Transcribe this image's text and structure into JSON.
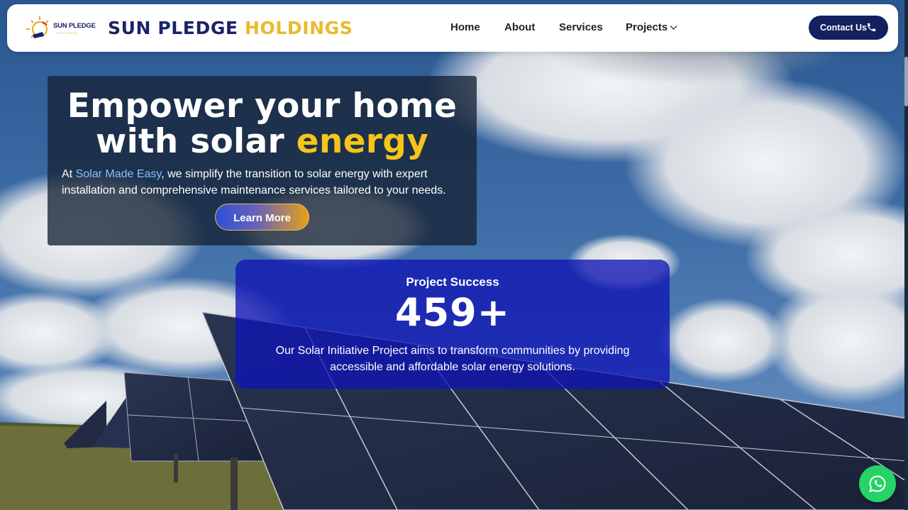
{
  "brand": {
    "logo_text": "SUN PLEDGE",
    "logo_subtext": "HOLDINGS",
    "name_part1": "SUN PLEDGE",
    "name_part2": "HOLDINGS"
  },
  "nav": {
    "items": [
      {
        "label": "Home"
      },
      {
        "label": "About"
      },
      {
        "label": "Services"
      },
      {
        "label": "Projects",
        "has_dropdown": true
      }
    ],
    "contact_label": "Contact Us",
    "contact_icon": "phone-icon"
  },
  "hero": {
    "title_line1": "Empower your home",
    "title_line2_part1": "with solar ",
    "title_line2_accent": "energy",
    "desc_prefix": "At ",
    "desc_link": "Solar Made Easy",
    "desc_rest": ", we simplify the transition to solar energy with expert installation and comprehensive maintenance services tailored to your needs.",
    "cta_label": "Learn More"
  },
  "stats": {
    "title": "Project Success",
    "value": "459+",
    "description": "Our Solar Initiative Project aims to transform communities by providing accessible and affordable solar energy solutions."
  },
  "floating": {
    "icon": "whatsapp-icon"
  },
  "colors": {
    "brand_navy": "#1b2366",
    "brand_gold": "#eab92c",
    "stats_blue": "#0f14b4",
    "whatsapp_green": "#25d366"
  }
}
